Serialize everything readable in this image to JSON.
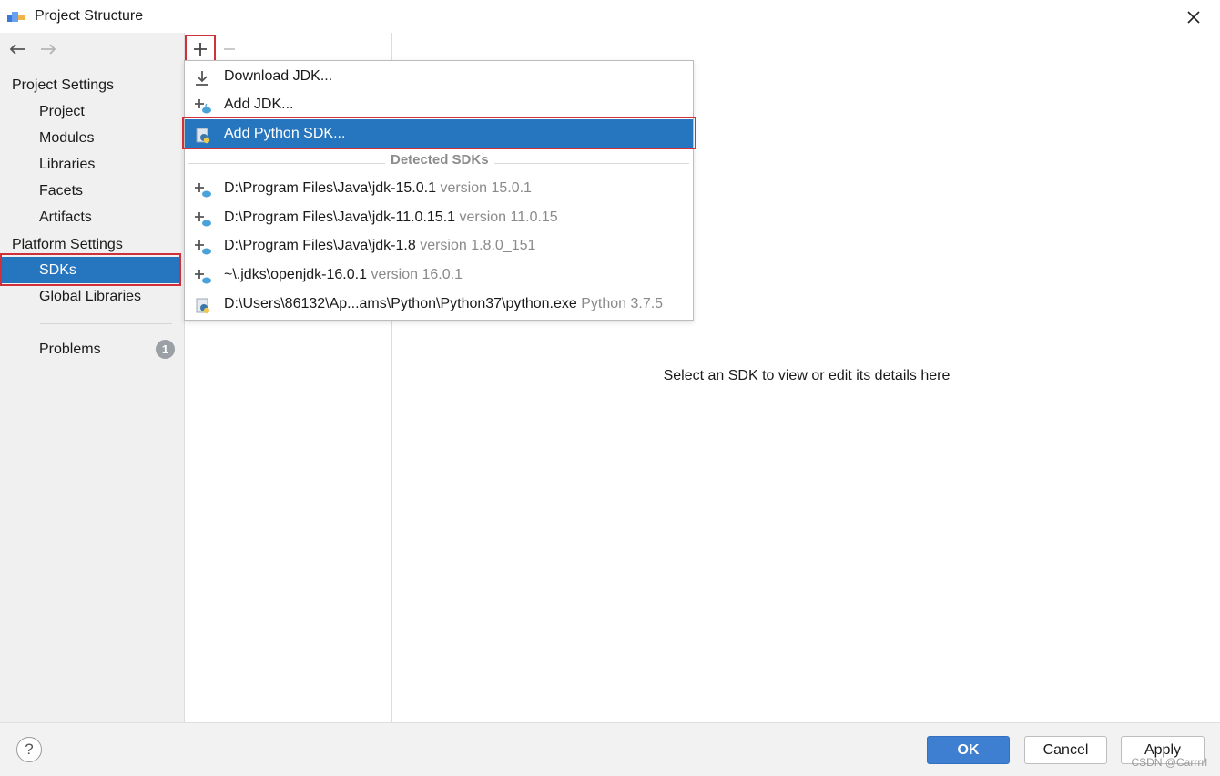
{
  "window": {
    "title": "Project Structure"
  },
  "icons": {
    "app": "intellij-app-icon",
    "close": "close-icon",
    "back": "arrow-left-icon",
    "forward": "arrow-right-icon",
    "add": "plus-icon",
    "remove": "minus-icon",
    "download": "download-icon",
    "jdk": "java-sdk-icon",
    "python": "python-sdk-icon",
    "help": "help-icon"
  },
  "colors": {
    "selection": "#2675bf",
    "highlight_box": "#d0303a",
    "primary_button": "#3f7fd1"
  },
  "sidebar": {
    "project_settings_header": "Project Settings",
    "project_items": [
      "Project",
      "Modules",
      "Libraries",
      "Facets",
      "Artifacts"
    ],
    "platform_settings_header": "Platform Settings",
    "platform_items": [
      "SDKs",
      "Global Libraries"
    ],
    "selected": "SDKs",
    "problems": {
      "label": "Problems",
      "count": "1"
    }
  },
  "popup": {
    "actions": [
      "Download JDK...",
      "Add JDK...",
      "Add Python SDK..."
    ],
    "active_action": "Add Python SDK...",
    "detected_header": "Detected SDKs",
    "detected": [
      {
        "path": "D:\\Program Files\\Java\\jdk-15.0.1",
        "version": "version 15.0.1",
        "kind": "java"
      },
      {
        "path": "D:\\Program Files\\Java\\jdk-11.0.15.1",
        "version": "version 11.0.15",
        "kind": "java"
      },
      {
        "path": "D:\\Program Files\\Java\\jdk-1.8",
        "version": "version 1.8.0_151",
        "kind": "java"
      },
      {
        "path": "~\\.jdks\\openjdk-16.0.1",
        "version": "version 16.0.1",
        "kind": "java"
      },
      {
        "path": "D:\\Users\\86132\\Ap...ams\\Python\\Python37\\python.exe",
        "version": "Python 3.7.5",
        "kind": "python"
      }
    ]
  },
  "detail": {
    "placeholder": "Select an SDK to view or edit its details here"
  },
  "footer": {
    "help_label": "?",
    "ok_label": "OK",
    "cancel_label": "Cancel",
    "apply_label": "Apply",
    "watermark": "CSDN @Carrrrl"
  }
}
